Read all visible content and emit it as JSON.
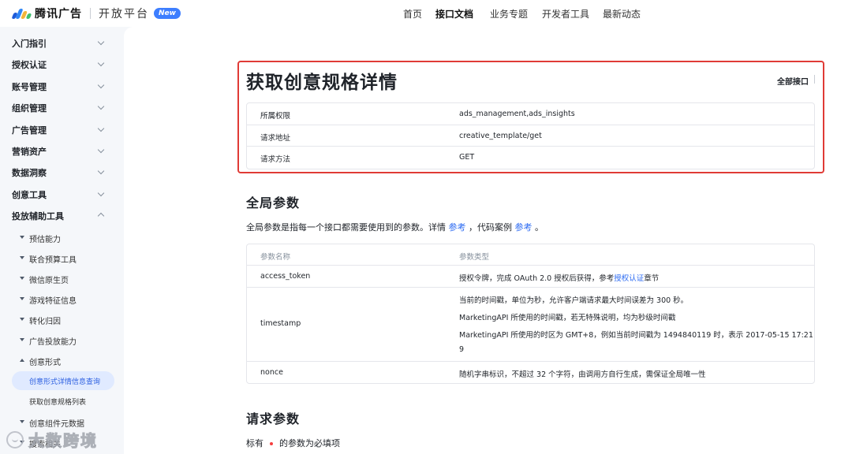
{
  "header": {
    "brand_name": "腾讯广告",
    "platform_name": "开放平台",
    "new_badge": "New",
    "brand_colors": [
      "#1f5bd8",
      "#2f86f6",
      "#f1b53a",
      "#3fbe6f"
    ],
    "nav": [
      {
        "label": "首页",
        "active": false
      },
      {
        "label": "接口文档",
        "active": true
      },
      {
        "label": "业务专题",
        "active": false
      },
      {
        "label": "开发者工具",
        "active": false
      },
      {
        "label": "最新动态",
        "active": false
      }
    ]
  },
  "sidebar": {
    "sections": [
      {
        "label": "入门指引",
        "expanded": false
      },
      {
        "label": "授权认证",
        "expanded": false
      },
      {
        "label": "账号管理",
        "expanded": false
      },
      {
        "label": "组织管理",
        "expanded": false
      },
      {
        "label": "广告管理",
        "expanded": false
      },
      {
        "label": "营销资产",
        "expanded": false
      },
      {
        "label": "数据洞察",
        "expanded": false
      },
      {
        "label": "创意工具",
        "expanded": false
      },
      {
        "label": "投放辅助工具",
        "expanded": true
      }
    ],
    "sub_items": [
      {
        "label": "预估能力",
        "expanded": false
      },
      {
        "label": "联合预算工具",
        "expanded": false
      },
      {
        "label": "微信原生页",
        "expanded": false
      },
      {
        "label": "游戏特征信息",
        "expanded": false
      },
      {
        "label": "转化归因",
        "expanded": false
      },
      {
        "label": "广告投放能力",
        "expanded": false
      },
      {
        "label": "创意形式",
        "expanded": true
      }
    ],
    "leaf_items": [
      {
        "label": "创意形式详情信息查询",
        "active": true
      },
      {
        "label": "获取创意规格列表",
        "active": false
      }
    ],
    "after_items": [
      {
        "label": "创意组件元数据",
        "expanded": false
      },
      {
        "label": "搜索相关",
        "expanded": false
      }
    ]
  },
  "page": {
    "title": "获取创意规格详情",
    "all_api_link": "全部接口",
    "info_rows": [
      {
        "key": "所属权限",
        "value": "ads_management,ads_insights"
      },
      {
        "key": "请求地址",
        "value": "creative_template/get"
      },
      {
        "key": "请求方法",
        "value": "GET"
      }
    ],
    "global_params": {
      "heading": "全局参数",
      "desc_before": "全局参数是指每一个接口都需要使用到的参数。详情 ",
      "desc_link1": "参考",
      "desc_middle": " ，代码案例 ",
      "desc_link2": "参考",
      "desc_after": " 。",
      "columns": [
        "参数名称",
        "参数类型"
      ],
      "rows": [
        {
          "name": "access_token",
          "lines": [
            "授权令牌，完成 OAuth 2.0 授权后获得，参考"
          ],
          "link": "授权认证",
          "link_suffix": "章节"
        },
        {
          "name": "timestamp",
          "lines": [
            "当前的时间戳，单位为秒，允许客户端请求最大时间误差为 300 秒。",
            "MarketingAPI 所使用的时间戳，若无特殊说明，均为秒级时间戳",
            "MarketingAPI 所使用的时区为 GMT+8，例如当前时间戳为 1494840119 时，表示 2017-05-15 17:21:5",
            "9"
          ]
        },
        {
          "name": "nonce",
          "lines": [
            "随机字串标识，不超过 32 个字符，由调用方自行生成，需保证全局唯一性"
          ]
        }
      ]
    },
    "request_params": {
      "heading": "请求参数",
      "note_before": "标有",
      "note_after": "的参数为必填项"
    }
  },
  "watermark": {
    "text": "大数跨境",
    "icon": "smile-logo-icon"
  }
}
